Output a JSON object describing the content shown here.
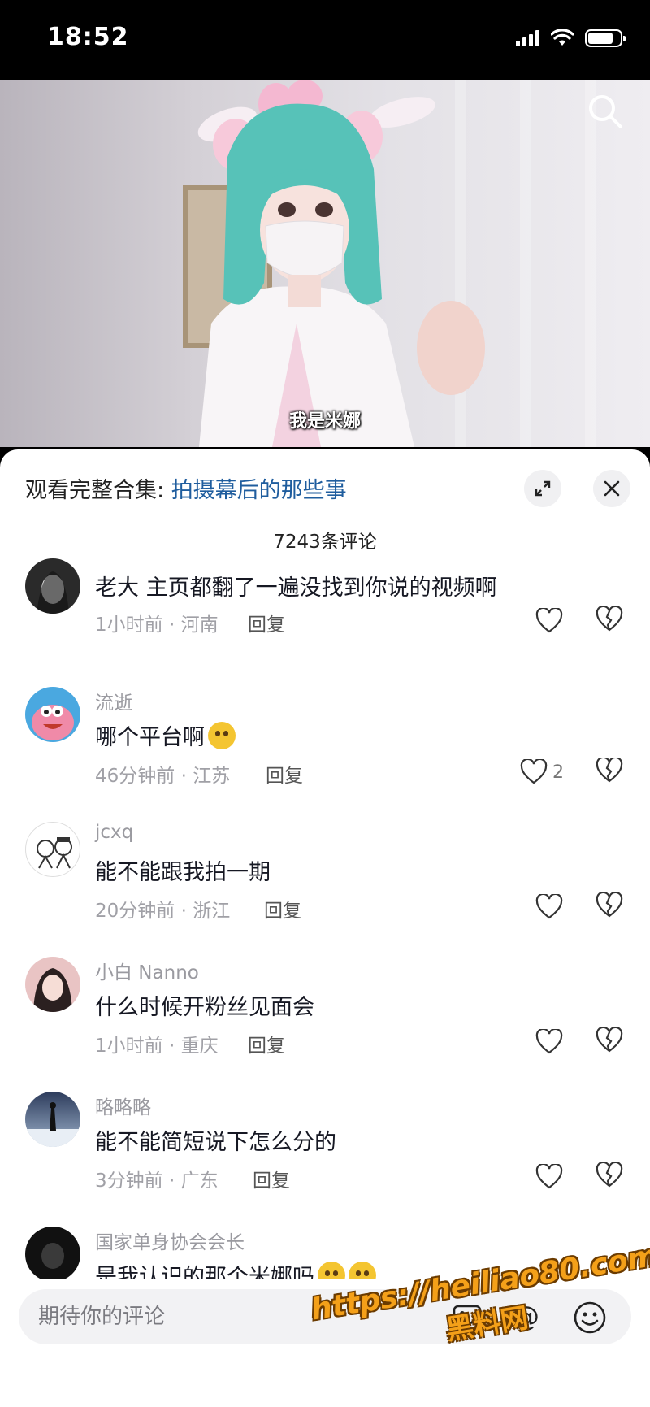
{
  "status_bar": {
    "time": "18:52",
    "battery_level": 0.8
  },
  "video": {
    "subtitle": "我是米娜"
  },
  "sheet": {
    "collection_prefix": "观看完整合集: ",
    "collection_link": "拍摄幕后的那些事",
    "comment_count": "7243条评论"
  },
  "comments": [
    {
      "username": "",
      "text": "老大 主页都翻了一遍没找到你说的视频啊",
      "time": "1小时前",
      "region": "河南",
      "reply": "回复",
      "likes": ""
    },
    {
      "username": "流逝",
      "text": "哪个平台啊",
      "time": "46分钟前",
      "region": "江苏",
      "reply": "回复",
      "likes": "2"
    },
    {
      "username": "jcxq",
      "text": "能不能跟我拍一期",
      "time": "20分钟前",
      "region": "浙江",
      "reply": "回复",
      "likes": ""
    },
    {
      "username": "小白 Nanno",
      "text": "什么时候开粉丝见面会",
      "time": "1小时前",
      "region": "重庆",
      "reply": "回复",
      "likes": ""
    },
    {
      "username": "略略略",
      "text": "能不能简短说下怎么分的",
      "time": "3分钟前",
      "region": "广东",
      "reply": "回复",
      "likes": ""
    },
    {
      "username": "国家单身协会会长",
      "text": "是我认识的那个米娜吗",
      "time": "",
      "region": "",
      "reply": "",
      "likes": ""
    }
  ],
  "input": {
    "placeholder": "期待你的评论",
    "at_symbol": "@"
  },
  "watermark": {
    "url": "https://heiliao80.com",
    "name": "黑料网"
  },
  "colors": {
    "link": "#1f5d9e",
    "username": "#9a9aa0",
    "watermark": "#f4a019"
  }
}
